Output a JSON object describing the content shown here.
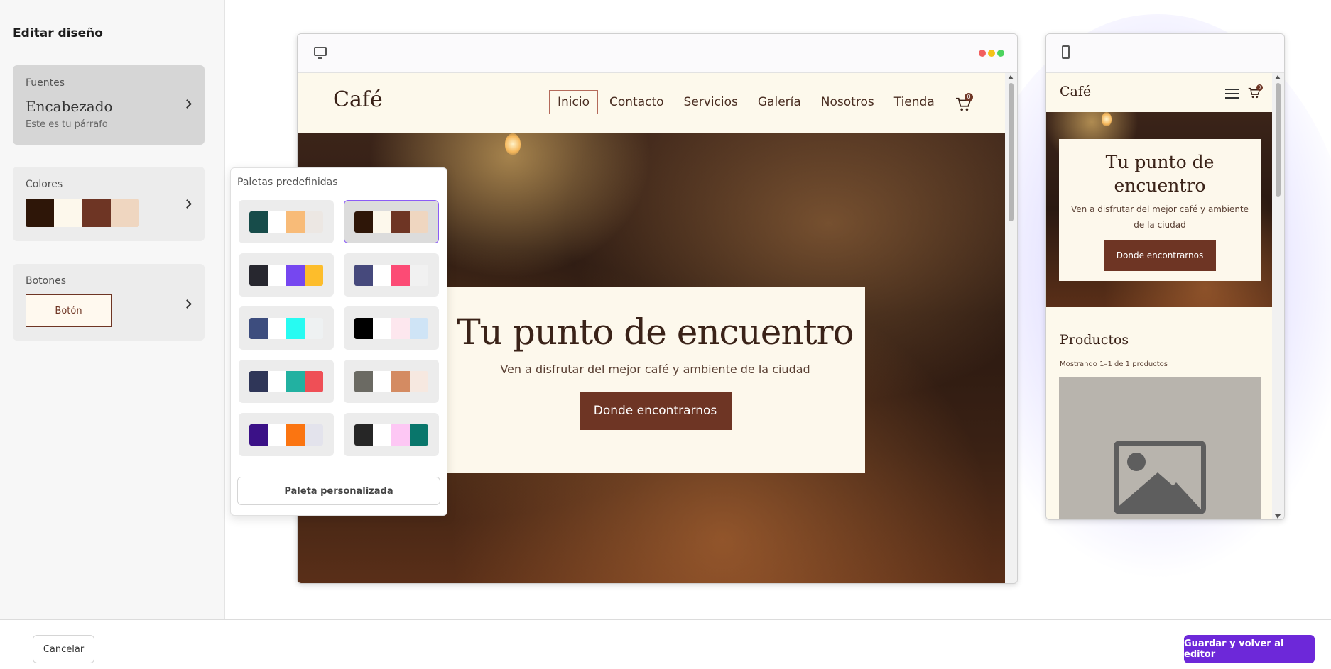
{
  "sidebar": {
    "title": "Editar diseño",
    "fonts": {
      "label": "Fuentes",
      "heading_sample": "Encabezado",
      "paragraph_sample": "Este es tu párrafo"
    },
    "colors": {
      "label": "Colores",
      "swatches": [
        "#2e1608",
        "#fdf8ec",
        "#6e3524",
        "#efd6c0"
      ]
    },
    "buttons": {
      "label": "Botones",
      "sample": "Botón"
    }
  },
  "palette_popup": {
    "title": "Paletas predefinidas",
    "custom_button": "Paleta personalizada",
    "palettes": [
      [
        "#174c4a",
        "#ffffff",
        "#f8bb78",
        "#ece7e3"
      ],
      [
        "#2e1608",
        "#fdf8ec",
        "#6e3524",
        "#efd6c0"
      ],
      [
        "#27272f",
        "#ffffff",
        "#7647f0",
        "#fdbd2b"
      ],
      [
        "#46497c",
        "#ffffff",
        "#fc4b75",
        "#f1f1f1"
      ],
      [
        "#3d4d7e",
        "#ffffff",
        "#27fbf2",
        "#eef1f2"
      ],
      [
        "#000000",
        "#ffffff",
        "#fde7ee",
        "#cfe4f6"
      ],
      [
        "#2f3658",
        "#ffffff",
        "#22b1a1",
        "#ef4f56"
      ],
      [
        "#6b6a63",
        "#ffffff",
        "#d48b62",
        "#f6e8e0"
      ],
      [
        "#3b1187",
        "#ffffff",
        "#fb7511",
        "#e3e3ec"
      ],
      [
        "#262626",
        "#ffffff",
        "#fdc7f4",
        "#09766b"
      ]
    ],
    "selected_index": 1
  },
  "desktop_preview": {
    "dots": [
      "#f25f5f",
      "#f5c218",
      "#4cd35e"
    ],
    "logo": "Café",
    "nav": [
      "Inicio",
      "Contacto",
      "Servicios",
      "Galería",
      "Nosotros",
      "Tienda"
    ],
    "cart_count": "0",
    "hero": {
      "title": "Tu punto de encuentro",
      "subtitle": "Ven a disfrutar del mejor café y ambiente de la ciudad",
      "button": "Donde encontrarnos"
    }
  },
  "mobile_preview": {
    "logo": "Café",
    "cart_count": "0",
    "hero": {
      "title": "Tu punto de encuentro",
      "subtitle": "Ven a disfrutar del mejor café y ambiente de la ciudad",
      "button": "Donde encontrarnos"
    },
    "products_title": "Productos",
    "products_count": "Mostrando 1–1 de 1 productos"
  },
  "footer": {
    "cancel": "Cancelar",
    "save": "Guardar y volver al editor"
  }
}
